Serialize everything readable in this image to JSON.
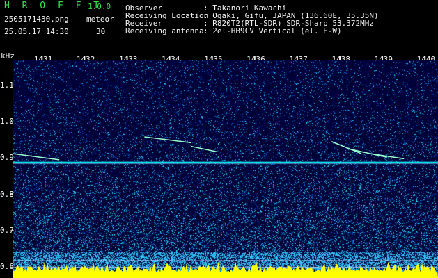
{
  "app": {
    "name": "H R O F F T",
    "version": "1.0.0",
    "filename": "2505171430.png",
    "datetime": "25.05.17 14:30",
    "mode_label": "meteor",
    "count": "30"
  },
  "info": {
    "rows": [
      {
        "label": "Observer",
        "value": ": Takanori Kawachi"
      },
      {
        "label": "Receiving Location",
        "value": ": Ogaki, Gifu, JAPAN (136.60E, 35.35N)"
      },
      {
        "label": "Receiver",
        "value": ": R820T2(RTL-SDR) SDR-Sharp 53.372MHz"
      },
      {
        "label": "Receiving antenna",
        "value": ": 2el-HB9CV Vertical (el. E-W)"
      }
    ]
  },
  "colors": {
    "green": "#35e04a",
    "background": "#000000",
    "noise": "#0a1aa8",
    "trace": "#00ffff",
    "baseline": "#ffff00"
  },
  "chart_data": {
    "type": "heatmap",
    "ylabel": "kHz",
    "x_ticks": [
      "1431",
      "1432",
      "1433",
      "1434",
      "1435",
      "1436",
      "1437",
      "1438",
      "1439",
      "1440"
    ],
    "y_ticks": [
      "1.1",
      "1.0",
      "0.9",
      "0.8",
      "0.7",
      "0.6"
    ],
    "ylim": [
      0.57,
      1.17
    ],
    "xlim": [
      1430.3,
      1440.3
    ],
    "carrier_khz": 0.888,
    "meteor_traces": [
      {
        "x": [
          1430.3,
          1431.4
        ],
        "y": [
          0.912,
          0.895
        ]
      },
      {
        "x": [
          1433.4,
          1434.5
        ],
        "y": [
          0.958,
          0.942
        ]
      },
      {
        "x": [
          1434.5,
          1435.1
        ],
        "y": [
          0.932,
          0.917
        ]
      },
      {
        "x": [
          1437.8,
          1438.5
        ],
        "y": [
          0.945,
          0.912
        ]
      },
      {
        "x": [
          1438.2,
          1439.1
        ],
        "y": [
          0.925,
          0.902
        ]
      },
      {
        "x": [
          1438.7,
          1439.5
        ],
        "y": [
          0.912,
          0.898
        ]
      }
    ]
  }
}
